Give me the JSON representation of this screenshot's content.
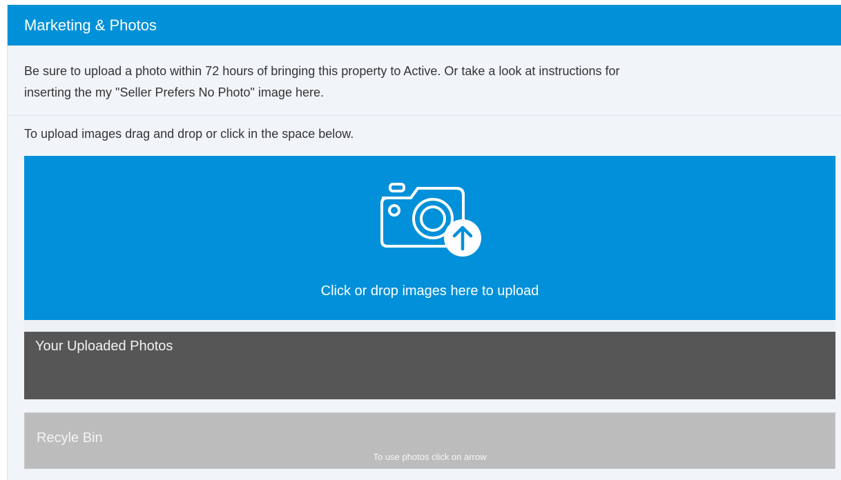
{
  "panel": {
    "title": "Marketing & Photos",
    "notice_line1": "Be sure to upload a photo within 72 hours of bringing this property to Active. Or take a look at instructions for",
    "notice_line2": "inserting the my \"Seller Prefers No Photo\" image here.",
    "upload_hint": "To upload images drag and drop or click in the space below."
  },
  "dropzone": {
    "label": "Click or drop images here to upload",
    "icon": "camera-upload-icon"
  },
  "uploaded": {
    "title": "Your Uploaded Photos"
  },
  "recycle": {
    "title": "Recyle Bin",
    "hint": "To use photos click on arrow"
  },
  "colors": {
    "accent": "#0191d8",
    "uploaded_bg": "#565656",
    "recycle_bg": "#bcbcbc"
  }
}
